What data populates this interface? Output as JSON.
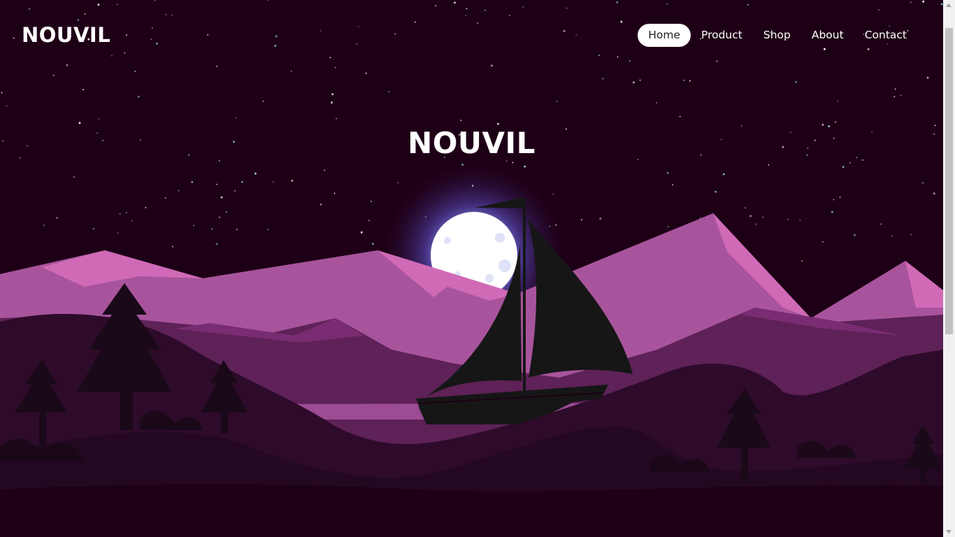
{
  "brand": {
    "logo_text": "NOUVIL"
  },
  "nav": {
    "items": [
      {
        "label": "Home",
        "active": true
      },
      {
        "label": "Product",
        "active": false
      },
      {
        "label": "Shop",
        "active": false
      },
      {
        "label": "About",
        "active": false
      },
      {
        "label": "Contact",
        "active": false
      }
    ]
  },
  "hero": {
    "title": "NOUVIL",
    "illustration": "night-sky-mountains-sailboat"
  },
  "colors": {
    "sky": "#1e0016",
    "mountain_far": "#a8549c",
    "mountain_highlight": "#d06ab7",
    "mountain_mid": "#5e2158",
    "hill_dark": "#2e0b2a",
    "silhouette": "#161616",
    "moon": "#ffffff",
    "moon_glow": "#6b6bd6"
  }
}
